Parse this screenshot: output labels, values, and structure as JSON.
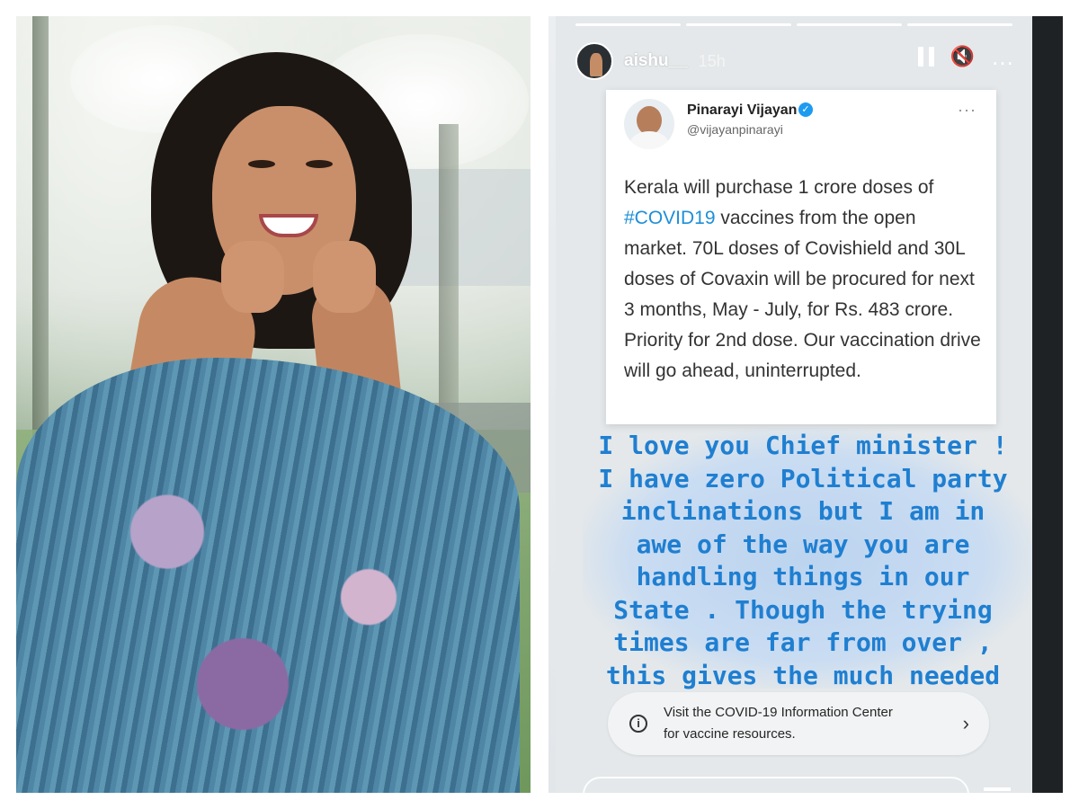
{
  "story": {
    "username": "aishu__",
    "time": "15h",
    "icons": {
      "pause": "pause-icon",
      "mute": "speaker-mute-icon",
      "more": "more-options-icon",
      "info": "info-icon",
      "chevron": "chevron-right-icon"
    },
    "tweet": {
      "name": "Pinarayi Vijayan",
      "handle": "@vijayanpinarayi",
      "text_before": "Kerala will purchase 1 crore doses of ",
      "hashtag": "#COVID19",
      "text_after": " vaccines from the open market. 70L doses of Covishield and 30L doses of Covaxin will be procured for next 3 months, May - July, for Rs. 483 crore. Priority for 2nd dose. Our vaccination drive will go ahead, uninterrupted."
    },
    "caption": "I love you Chief minister ! I have zero Political party inclinations but I am in awe of the way you are handling things in our State . Though the trying times are far from over , this gives the much needed ray of hope.",
    "info_line1": "Visit the COVID-19 Information Center",
    "info_line2": "for vaccine resources."
  },
  "colors": {
    "caption": "#1f7fd1",
    "hashtag": "#1d8fd8",
    "verified": "#1d9bf0"
  }
}
